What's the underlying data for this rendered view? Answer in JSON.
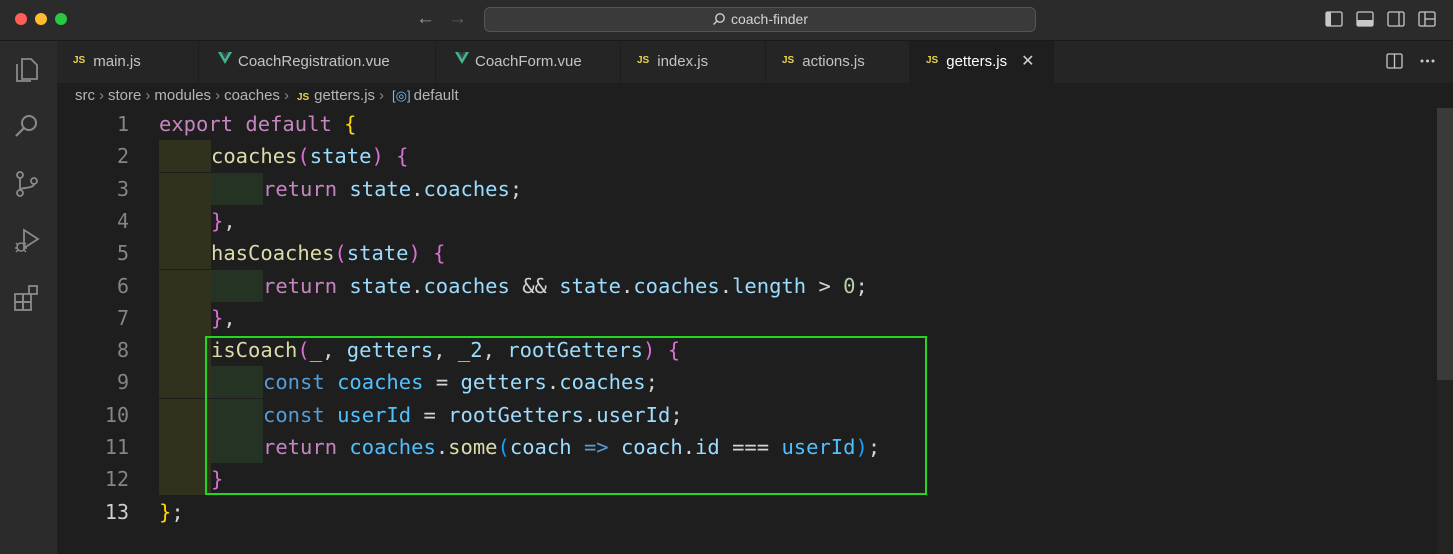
{
  "window": {
    "search_text": "coach-finder"
  },
  "tabs": [
    {
      "label": "main.js",
      "type": "js",
      "active": false
    },
    {
      "label": "CoachRegistration.vue",
      "type": "vue",
      "active": false
    },
    {
      "label": "CoachForm.vue",
      "type": "vue",
      "active": false
    },
    {
      "label": "index.js",
      "type": "js",
      "active": false
    },
    {
      "label": "actions.js",
      "type": "js",
      "active": false
    },
    {
      "label": "getters.js",
      "type": "js",
      "active": true
    }
  ],
  "icons": {
    "js_label": "JS",
    "symbol_glyph": "[◎]",
    "close_glyph": "✕"
  },
  "breadcrumb": {
    "items": [
      "src",
      "store",
      "modules",
      "coaches",
      "getters.js",
      "default"
    ],
    "separator": "›"
  },
  "editor": {
    "language": "javascript",
    "current_line": 13,
    "highlighted_lines": [
      8,
      12
    ],
    "line_numbers": [
      "1",
      "2",
      "3",
      "4",
      "5",
      "6",
      "7",
      "8",
      "9",
      "10",
      "11",
      "12",
      "13"
    ],
    "lines": [
      "export default {",
      "  coaches(state) {",
      "    return state.coaches;",
      "  },",
      "  hasCoaches(state) {",
      "    return state.coaches && state.coaches.length > 0;",
      "  },",
      "  isCoach(_, getters, _2, rootGetters) {",
      "    const coaches = getters.coaches;",
      "    const userId = rootGetters.userId;",
      "    return coaches.some(coach => coach.id === userId);",
      "  }",
      "};"
    ]
  },
  "colors": {
    "keyword": "#c586c0",
    "storage": "#569cd6",
    "function": "#dcdcaa",
    "variable": "#9cdcfe",
    "constant": "#4fc1ff",
    "number": "#b5cea8",
    "bracket_1": "#ffd700",
    "bracket_2": "#da70d6",
    "bracket_3": "#179fff",
    "highlight_box": "#22d622"
  }
}
